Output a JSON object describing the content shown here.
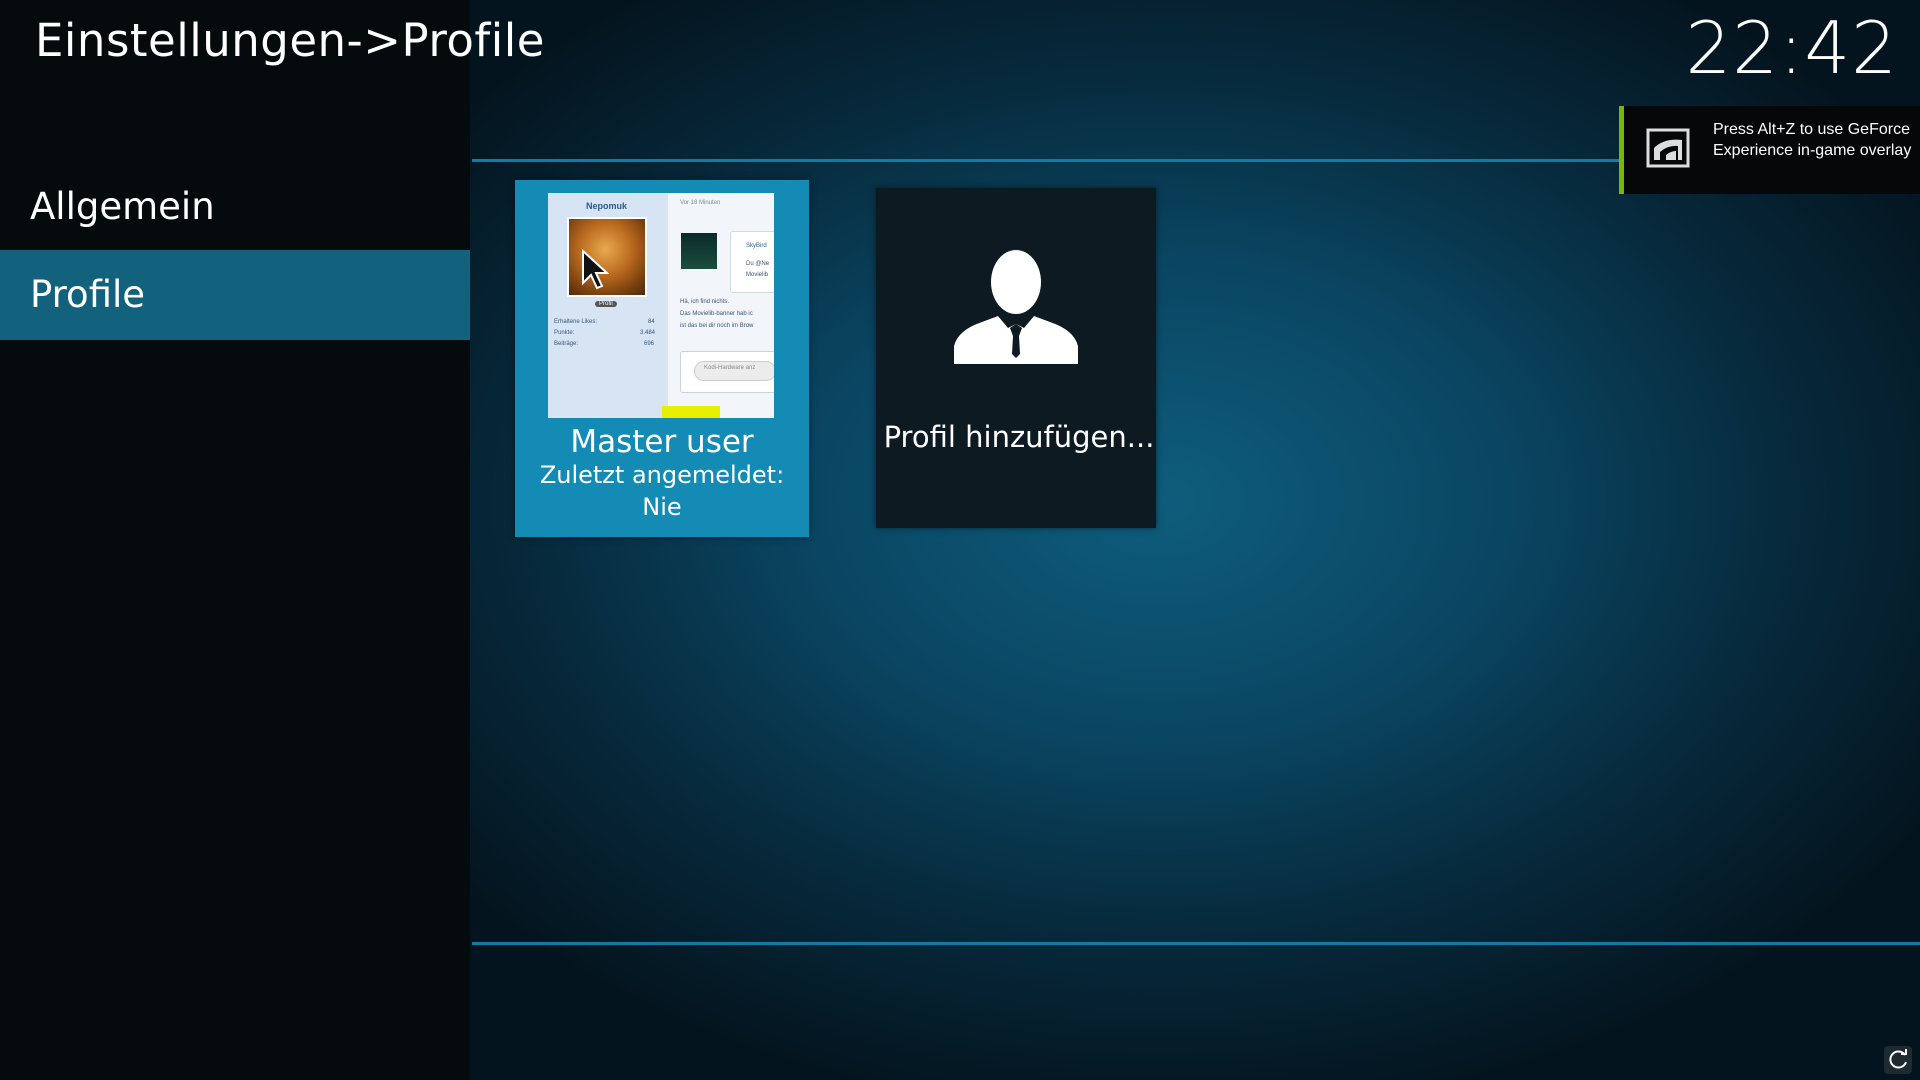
{
  "header": {
    "title": "Einstellungen->Profile",
    "clock": "22:42"
  },
  "sidebar": {
    "items": [
      {
        "label": "Allgemein",
        "selected": false
      },
      {
        "label": "Profile",
        "selected": true
      }
    ]
  },
  "profiles": [
    {
      "name": "Master user",
      "last_login_label": "Zuletzt angemeldet:",
      "last_login_value": "Nie",
      "focused": true,
      "thumbnail": {
        "username": "Nepomuk",
        "badge": "Profil",
        "stats": [
          {
            "label": "Erhaltene Likes:",
            "value": "84"
          },
          {
            "label": "Punkte:",
            "value": "3.484"
          },
          {
            "label": "Beiträge:",
            "value": "696"
          }
        ],
        "time": "Vor 18 Minuten",
        "reply_user": "SkyBird",
        "reply_lines": [
          "Du @Ne",
          "Movielib"
        ],
        "message_lines": [
          "Hä, ich find nichts.",
          "Das Movielib-banner hab ic",
          "ist das bei dir noch im Brow"
        ],
        "input_text": "Kodi-Hardware anz"
      }
    }
  ],
  "add_profile": {
    "label": "Profil hinzufügen..."
  },
  "notification": {
    "text": "Press Alt+Z to use GeForce Experience in-game overlay",
    "accent": "#76b900"
  },
  "colors": {
    "selected_bg": "#12627d",
    "focus_card_bg": "#138bb4",
    "line": "#127ba3"
  }
}
